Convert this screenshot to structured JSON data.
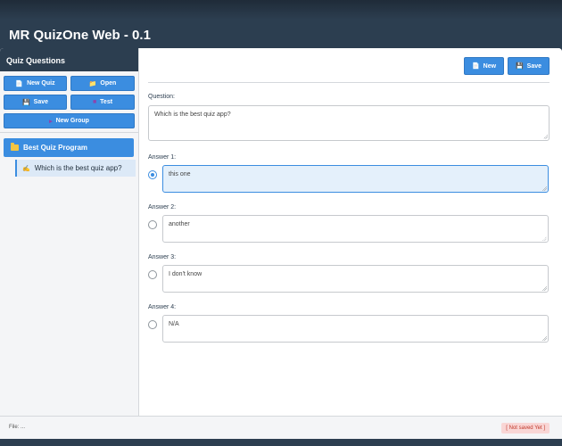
{
  "app": {
    "title": "MR QuizOne Web - 0.1"
  },
  "sidebar": {
    "title": "Quiz Questions",
    "buttons": {
      "new_quiz": "New Quiz",
      "open": "Open",
      "save": "Save",
      "test": "Test",
      "new_group": "New Group"
    },
    "tree": {
      "group_label": "Best Quiz Program",
      "question_label": "Which is the best quiz app?"
    }
  },
  "toolbar": {
    "new_label": "New",
    "save_label": "Save"
  },
  "editor": {
    "question_label": "Question:",
    "question_text": "Which is the best quiz app?",
    "answers": [
      {
        "label": "Answer 1:",
        "text": "this one",
        "selected": true
      },
      {
        "label": "Answer 2:",
        "text": "another",
        "selected": false
      },
      {
        "label": "Answer 3:",
        "text": "I don't know",
        "selected": false
      },
      {
        "label": "Answer 4:",
        "text": "N/A",
        "selected": false
      }
    ]
  },
  "status": {
    "file": "File: ...",
    "save_state": "[ Not saved Yet ]"
  },
  "icons": {
    "new_quiz": "document-icon",
    "open": "folder-icon",
    "save": "floppy-icon",
    "test": "test-icon",
    "new_group": "group-icon"
  },
  "colors": {
    "accent": "#3b8de0",
    "header": "#2c3e50",
    "unsaved_badge": "#f9d6d5"
  }
}
